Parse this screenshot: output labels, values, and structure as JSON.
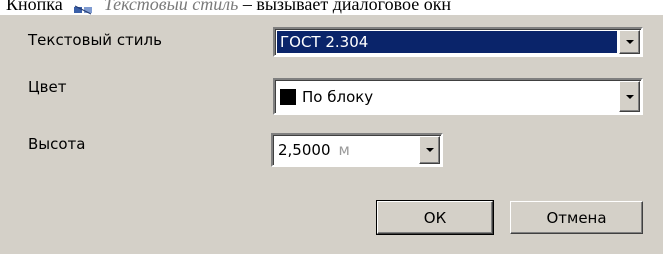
{
  "document_line": {
    "prefix": "Кнопка",
    "italic": "Текстовый стиль",
    "suffix": "– вызывает диалоговое окн"
  },
  "dialog": {
    "fields": {
      "text_style": {
        "label": "Текстовый стиль",
        "value": "ГОСТ 2.304"
      },
      "color": {
        "label": "Цвет",
        "value": "По блоку",
        "swatch_color": "#000000"
      },
      "height": {
        "label": "Высота",
        "value": "2,5000",
        "unit": "м"
      }
    },
    "buttons": {
      "ok": "ОК",
      "cancel": "Отмена"
    }
  },
  "colors": {
    "dialog_bg": "#d4d0c8",
    "selection_bg": "#0a246a",
    "selection_text": "#ffffff"
  }
}
